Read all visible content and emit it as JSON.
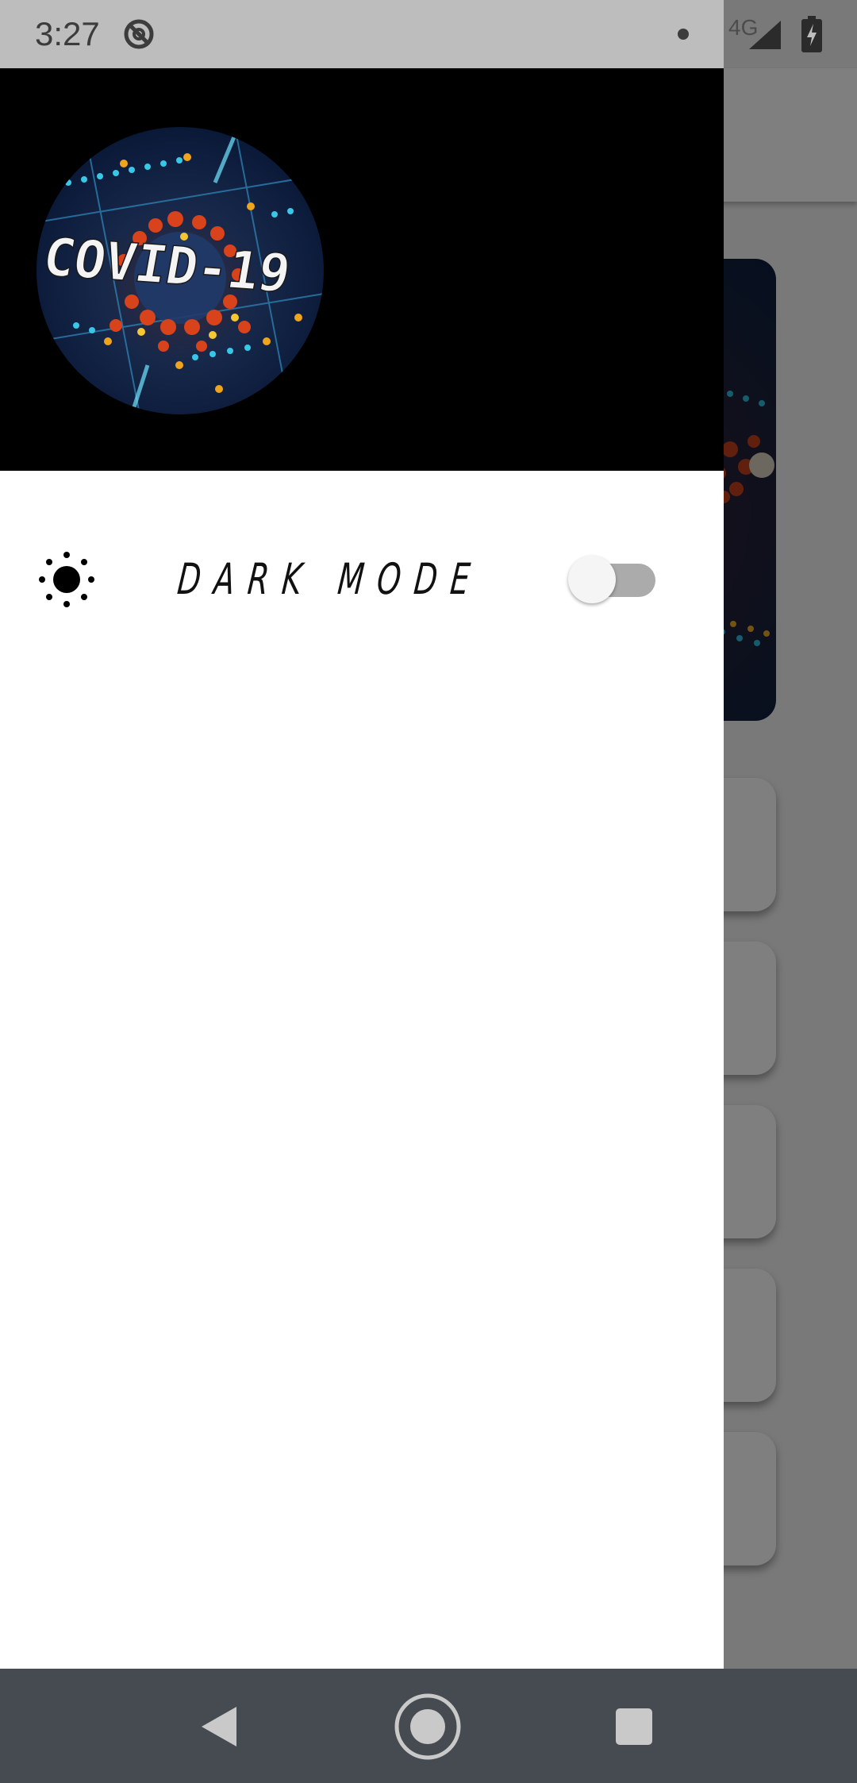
{
  "status_bar": {
    "time": "3:27",
    "network": "4G",
    "icons": [
      "sync-off-icon",
      "notification-dot-icon",
      "cell-signal-icon",
      "battery-charging-icon"
    ]
  },
  "drawer": {
    "logo_text": "COVID-19",
    "settings": [
      {
        "icon": "sun-icon",
        "label": "DARK MODE",
        "toggle_on": false
      }
    ]
  },
  "nav_bar": {
    "buttons": [
      "back-icon",
      "home-icon",
      "recents-icon"
    ]
  },
  "colors": {
    "drawer_header": "#000000",
    "drawer_body": "#ffffff",
    "status_bar": "#bdbdbd",
    "nav_bar": "#454b50",
    "toggle_track_off": "#ababab",
    "toggle_thumb": "#f5f5f5"
  }
}
